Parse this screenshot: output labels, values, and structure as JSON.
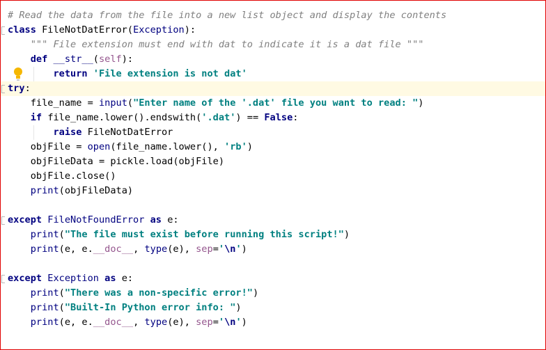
{
  "editor": {
    "lines": [
      {
        "parts": [
          {
            "t": "# Read the data from the file into a new list object and display the contents",
            "c": "cm"
          }
        ]
      },
      {
        "parts": [
          {
            "t": "class ",
            "c": "kw"
          },
          {
            "t": "FileNotDatError(",
            "c": ""
          },
          {
            "t": "Exception",
            "c": "bi"
          },
          {
            "t": "):",
            "c": ""
          }
        ]
      },
      {
        "parts": [
          {
            "t": "    \"\"\" File extension must end with dat to indicate it is a dat file \"\"\"",
            "c": "cm"
          }
        ]
      },
      {
        "parts": [
          {
            "t": "    ",
            "c": ""
          },
          {
            "t": "def ",
            "c": "kw"
          },
          {
            "t": "__str__",
            "c": "bi"
          },
          {
            "t": "(",
            "c": ""
          },
          {
            "t": "self",
            "c": "sp"
          },
          {
            "t": "):",
            "c": ""
          }
        ]
      },
      {
        "parts": [
          {
            "t": "        ",
            "c": ""
          },
          {
            "t": "return ",
            "c": "kw"
          },
          {
            "t": "'File extension is not dat'",
            "c": "st"
          }
        ]
      },
      {
        "parts": [
          {
            "t": "try",
            "c": "kw"
          },
          {
            "t": ":",
            "c": ""
          }
        ],
        "current": true
      },
      {
        "parts": [
          {
            "t": "    file_name = ",
            "c": ""
          },
          {
            "t": "input",
            "c": "bi"
          },
          {
            "t": "(",
            "c": ""
          },
          {
            "t": "\"Enter name of the '.dat' file you want to read: \"",
            "c": "st"
          },
          {
            "t": ")",
            "c": ""
          }
        ]
      },
      {
        "parts": [
          {
            "t": "    ",
            "c": ""
          },
          {
            "t": "if ",
            "c": "kw"
          },
          {
            "t": "file_name.lower().endswith(",
            "c": ""
          },
          {
            "t": "'.dat'",
            "c": "st"
          },
          {
            "t": ") == ",
            "c": ""
          },
          {
            "t": "False",
            "c": "lit"
          },
          {
            "t": ":",
            "c": ""
          }
        ]
      },
      {
        "parts": [
          {
            "t": "        ",
            "c": ""
          },
          {
            "t": "raise ",
            "c": "kw"
          },
          {
            "t": "FileNotDatError",
            "c": ""
          }
        ]
      },
      {
        "parts": [
          {
            "t": "    objFile = ",
            "c": ""
          },
          {
            "t": "open",
            "c": "bi"
          },
          {
            "t": "(file_name.lower(), ",
            "c": ""
          },
          {
            "t": "'rb'",
            "c": "st"
          },
          {
            "t": ")",
            "c": ""
          }
        ]
      },
      {
        "parts": [
          {
            "t": "    objFileData = pickle.load(objFile)",
            "c": ""
          }
        ]
      },
      {
        "parts": [
          {
            "t": "    objFile.close()",
            "c": ""
          }
        ]
      },
      {
        "parts": [
          {
            "t": "    ",
            "c": ""
          },
          {
            "t": "print",
            "c": "bi"
          },
          {
            "t": "(objFileData)",
            "c": ""
          }
        ]
      },
      {
        "parts": [
          {
            "t": "",
            "c": ""
          }
        ]
      },
      {
        "parts": [
          {
            "t": "except ",
            "c": "kw"
          },
          {
            "t": "FileNotFoundError ",
            "c": "bi"
          },
          {
            "t": "as ",
            "c": "kw"
          },
          {
            "t": "e:",
            "c": ""
          }
        ]
      },
      {
        "parts": [
          {
            "t": "    ",
            "c": ""
          },
          {
            "t": "print",
            "c": "bi"
          },
          {
            "t": "(",
            "c": ""
          },
          {
            "t": "\"The file must exist before running this script!\"",
            "c": "st"
          },
          {
            "t": ")",
            "c": ""
          }
        ]
      },
      {
        "parts": [
          {
            "t": "    ",
            "c": ""
          },
          {
            "t": "print",
            "c": "bi"
          },
          {
            "t": "(e, e.",
            "c": ""
          },
          {
            "t": "__doc__",
            "c": "sp"
          },
          {
            "t": ", ",
            "c": ""
          },
          {
            "t": "type",
            "c": "bi"
          },
          {
            "t": "(e), ",
            "c": ""
          },
          {
            "t": "sep",
            "c": "sp"
          },
          {
            "t": "=",
            "c": ""
          },
          {
            "t": "'",
            "c": "st"
          },
          {
            "t": "\\n",
            "c": "esc"
          },
          {
            "t": "'",
            "c": "st"
          },
          {
            "t": ")",
            "c": ""
          }
        ]
      },
      {
        "parts": [
          {
            "t": "",
            "c": ""
          }
        ]
      },
      {
        "parts": [
          {
            "t": "except ",
            "c": "kw"
          },
          {
            "t": "Exception ",
            "c": "bi"
          },
          {
            "t": "as ",
            "c": "kw"
          },
          {
            "t": "e:",
            "c": ""
          }
        ]
      },
      {
        "parts": [
          {
            "t": "    ",
            "c": ""
          },
          {
            "t": "print",
            "c": "bi"
          },
          {
            "t": "(",
            "c": ""
          },
          {
            "t": "\"There was a non-specific error!\"",
            "c": "st"
          },
          {
            "t": ")",
            "c": ""
          }
        ]
      },
      {
        "parts": [
          {
            "t": "    ",
            "c": ""
          },
          {
            "t": "print",
            "c": "bi"
          },
          {
            "t": "(",
            "c": ""
          },
          {
            "t": "\"Built-In Python error info: \"",
            "c": "st"
          },
          {
            "t": ")",
            "c": ""
          }
        ]
      },
      {
        "parts": [
          {
            "t": "    ",
            "c": ""
          },
          {
            "t": "print",
            "c": "bi"
          },
          {
            "t": "(e, e.",
            "c": ""
          },
          {
            "t": "__doc__",
            "c": "sp"
          },
          {
            "t": ", ",
            "c": ""
          },
          {
            "t": "type",
            "c": "bi"
          },
          {
            "t": "(e), ",
            "c": ""
          },
          {
            "t": "sep",
            "c": "sp"
          },
          {
            "t": "=",
            "c": ""
          },
          {
            "t": "'",
            "c": "st"
          },
          {
            "t": "\\n",
            "c": "esc"
          },
          {
            "t": "'",
            "c": "st"
          },
          {
            "t": ")",
            "c": ""
          }
        ]
      }
    ],
    "colors": {
      "keyword": "#000080",
      "comment": "#808080",
      "string": "#008080",
      "special": "#94558d",
      "current_line": "#fffae3",
      "border": "#e00000"
    },
    "gutter_icon": "lightbulb-icon"
  }
}
